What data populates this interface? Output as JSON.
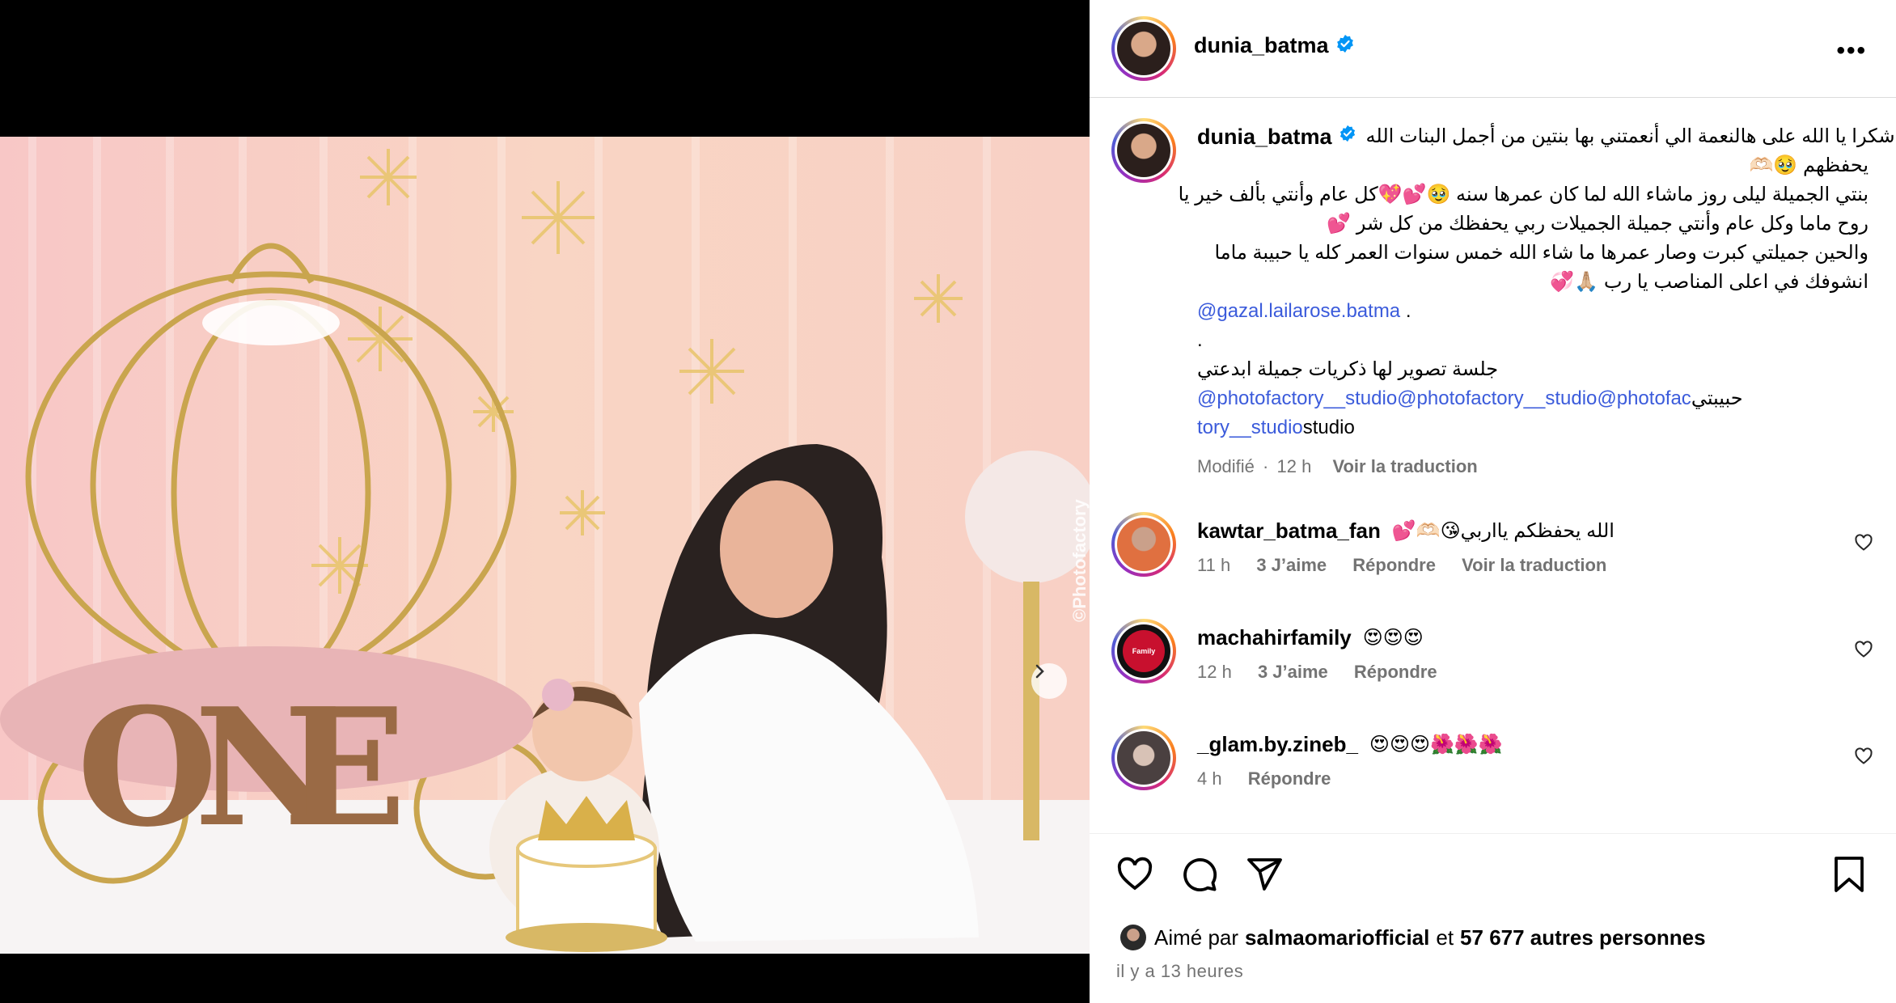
{
  "post": {
    "username": "dunia_batma",
    "watermark": "©Photofactory"
  },
  "caption": {
    "username": "dunia_batma",
    "lines": [
      "شكرا يا الله على هالنعمة الي أنعمتني بها بنتين من أجمل البنات الله",
      "يحفظهم 🥹🫶🏻",
      "بنتي الجميلة ليلى روز ماشاء الله لما كان عمرها سنه 🥹💕💖كل عام وأنتي بألف خير يا",
      "روح ماما وكل عام وأنتي جميلة الجميلات ربي يحفظك من كل شر 💕",
      "والحين جميلتي كبرت وصار عمرها ما شاء الله خمس سنوات العمر كله يا حبيبة ماما",
      "انشوفك في اعلى المناصب يا رب 🙏🏼💞"
    ],
    "mention_line_mention": "@gazal.lailarose.batma",
    "mention_line_suffix": ".",
    "dot_line": ".",
    "session_line": "جلسة تصوير لها ذكريات جميلة ابدعتي",
    "studio_line_1_mention": "@photofactory__studio@photofactory__studio@photofac",
    "studio_line_1_suffix": "حبيبتي",
    "studio_line_2_mention": "tory__studio",
    "studio_line_2_suffix": "studio",
    "edited": "Modifié",
    "time": "12 h",
    "translate": "Voir la traduction"
  },
  "comments": [
    {
      "username": "kawtar_batma_fan",
      "text": "الله يحفظكم يااربي😘🫶🏻💕",
      "time": "11 h",
      "likes": "3 J’aime",
      "reply": "Répondre",
      "translate": "Voir la traduction"
    },
    {
      "username": "machahirfamily",
      "text": "😍😍😍",
      "time": "12 h",
      "likes": "3 J’aime",
      "reply": "Répondre"
    },
    {
      "username": "_glam.by.zineb_",
      "text": "😍😍😍🌺🌺🌺",
      "time": "4 h",
      "reply": "Répondre"
    }
  ],
  "likes": {
    "prefix": "Aimé par",
    "user": "salmaomariofficial",
    "middle": "et",
    "count": "57 677 autres personnes"
  },
  "posted_ago": "il y a 13 heures",
  "avatar_badges": {
    "machahir": "Family"
  },
  "colors": {
    "link": "#3b5bdb",
    "verified": "#0095f6",
    "muted": "#737373"
  }
}
